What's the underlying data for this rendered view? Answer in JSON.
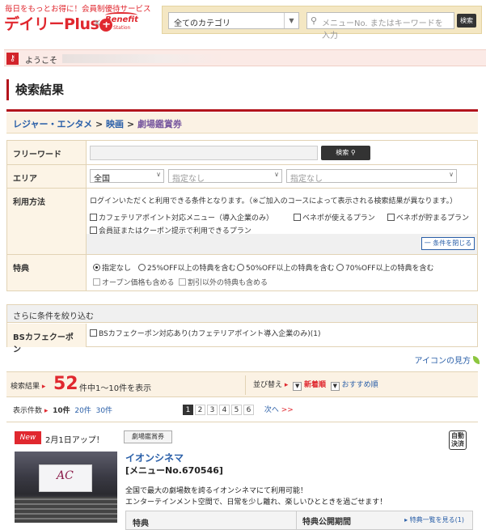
{
  "header": {
    "tagline": "毎日をもっとお得に！会員制優待サービス",
    "logo_text": "デイリーPlus",
    "logo_mark": "+",
    "times": "×",
    "partner_logo": "Benefit",
    "partner_sub": "Station",
    "category_select": "全てのカテゴリ",
    "keyword_placeholder": "メニューNo. またはキーワードを入力",
    "search_button": "検索"
  },
  "welcome": {
    "text": "ようこそ"
  },
  "page": {
    "title": "検索結果",
    "breadcrumb": [
      "レジャー・エンタメ",
      "映画",
      "劇場鑑賞券"
    ],
    "breadcrumb_sep": ">"
  },
  "form": {
    "freeword": {
      "label": "フリーワード",
      "button": "検索"
    },
    "area": {
      "label": "エリア",
      "select1": "全国",
      "select2": "指定なし",
      "select3": "指定なし"
    },
    "method": {
      "label": "利用方法",
      "note": "ログインいただくと利用できる条件となります。（※ご加入のコースによって表示される検索結果が異なります。）",
      "options": [
        "カフェテリアポイント対応メニュー（導入企業のみ）",
        "ベネポが使えるプラン",
        "ベネポが貯まるプラン",
        "会員証またはクーポン提示で利用できるプラン"
      ],
      "collapse_button": "一 条件を閉じる"
    },
    "benefit": {
      "label": "特典",
      "radios": [
        "指定なし",
        "25%OFF以上の特典を含む",
        "50%OFF以上の特典を含む",
        "70%OFF以上の特典を含む"
      ],
      "checks": [
        "オープン価格も含める",
        "割引以外の特典も含める"
      ]
    },
    "refine": {
      "head": "さらに条件を絞り込む",
      "label": "BSカフェクーポン",
      "option": "BSカフェクーポン対応あり(カフェテリアポイント導入企業のみ)(1)"
    }
  },
  "icon_guide": "アイコンの見方",
  "results": {
    "label": "検索結果",
    "count": "52",
    "range_text": "件中1～10件を表示",
    "sort_label": "並び替え",
    "sort_new": "新着順",
    "sort_recommended": "おすすめ順",
    "arrow": "▸",
    "dropdown": "▼"
  },
  "perpage": {
    "label": "表示件数",
    "current": "10件",
    "opt2": "20件",
    "opt3": "30件"
  },
  "pager": {
    "pages": [
      "1",
      "2",
      "3",
      "4",
      "5",
      "6"
    ],
    "next": "次へ",
    "next_arrows": ">>"
  },
  "card": {
    "badge": "New",
    "update": "2月1日アップ！",
    "tag": "劇場鑑賞券",
    "auto_line1": "自動",
    "auto_line2": "決済",
    "name": "イオンシネマ",
    "menu_no": "[メニューNo.670546]",
    "desc1": "全国で最大の劇場数を誇るイオンシネマにて利用可能！",
    "desc2": "エンターテインメント空間で、日常を少し離れ、楽しいひとときを過ごせます！",
    "col_benefit": "特典",
    "col_period": "特典公開期間",
    "list_link": "▸ 特典一覧を見る(1)",
    "thumb_logo": "AC"
  },
  "colors": {
    "brand": "#e0282f",
    "accent": "#b3141c",
    "link": "#2a5fa8"
  }
}
